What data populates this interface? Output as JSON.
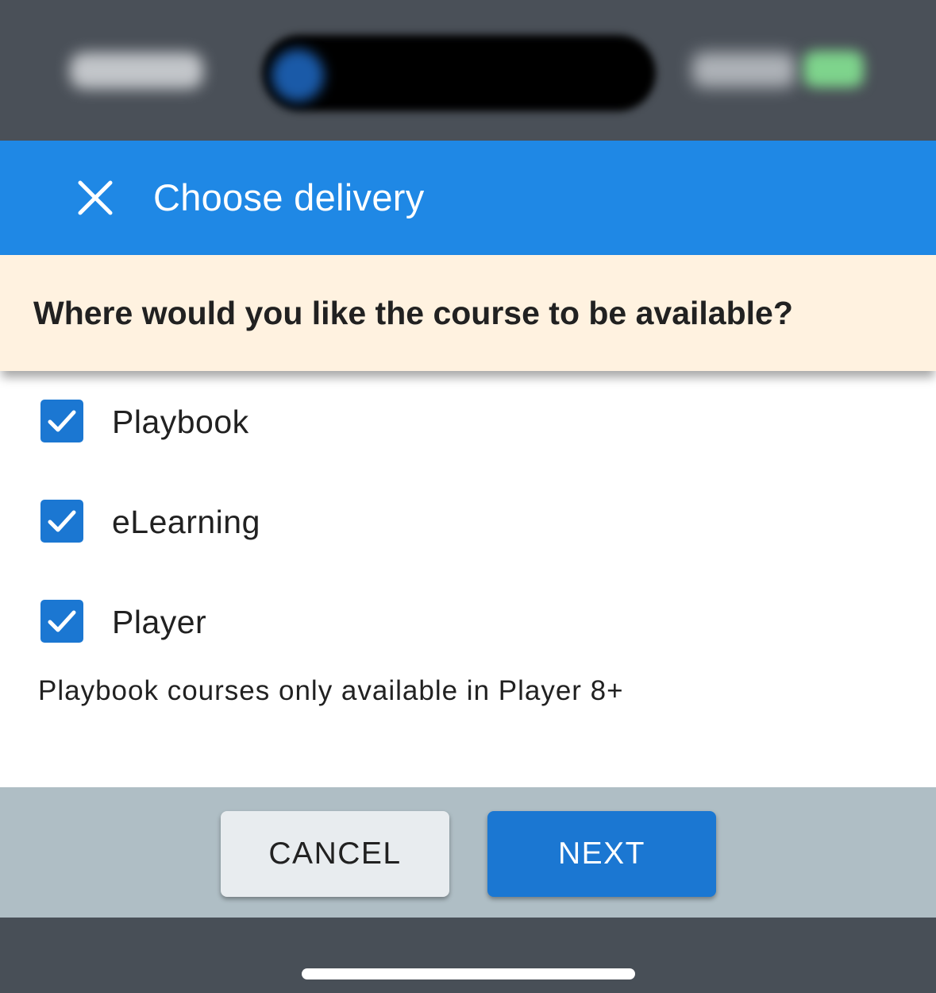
{
  "app_bar": {
    "title": "Choose delivery"
  },
  "banner": {
    "question": "Where would you like the course to be available?"
  },
  "options": [
    {
      "label": "Playbook",
      "checked": true
    },
    {
      "label": "eLearning",
      "checked": true
    },
    {
      "label": "Player",
      "checked": true
    }
  ],
  "note": "Playbook courses only available in Player 8+",
  "actions": {
    "cancel_label": "CANCEL",
    "next_label": "NEXT"
  },
  "colors": {
    "app_bar": "#1f88e5",
    "banner": "#fff2e0",
    "checkbox": "#1b77d2",
    "action_bar": "#afbec5",
    "next_button": "#1b77d2"
  },
  "icons": {
    "close": "close-icon",
    "check": "check-icon"
  }
}
